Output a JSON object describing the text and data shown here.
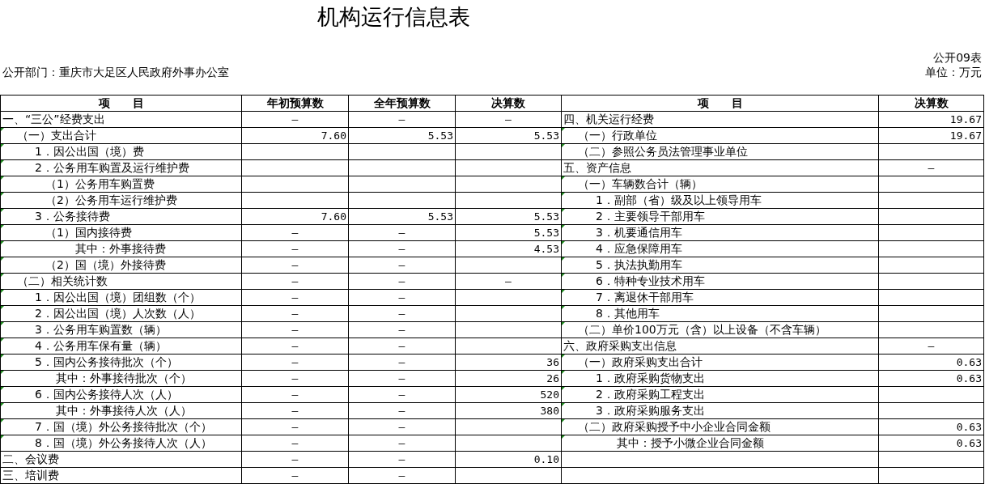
{
  "title": "机构运行信息表",
  "form_no": "公开09表",
  "department": "公开部门：重庆市大足区人民政府外事办公室",
  "unit": "单位：万元",
  "left_columns": [
    "项　　目",
    "年初预算数",
    "全年预算数",
    "决算数"
  ],
  "right_columns": [
    "项　　目",
    "决算数"
  ],
  "left_rows": [
    {
      "kind": "section",
      "flagged": false,
      "item": "一、“三公”经费支出",
      "values": [
        "—",
        "—",
        "—"
      ]
    },
    {
      "kind": "group",
      "flagged": true,
      "item": "（一）支出合计",
      "values": [
        "7.60",
        "5.53",
        "5.53"
      ]
    },
    {
      "kind": "item",
      "flagged": true,
      "item": "1．因公出国（境）费",
      "values": []
    },
    {
      "kind": "item",
      "flagged": true,
      "item": "2．公务用车购置及运行维护费",
      "values": []
    },
    {
      "kind": "subitem",
      "flagged": true,
      "item": "（1）公务用车购置费",
      "values": []
    },
    {
      "kind": "subitem",
      "flagged": true,
      "item": "（2）公务用车运行维护费",
      "values": []
    },
    {
      "kind": "item",
      "flagged": true,
      "item": "3．公务接待费",
      "values": [
        "7.60",
        "5.53",
        "5.53"
      ]
    },
    {
      "kind": "subitem",
      "flagged": true,
      "item": "（1）国内接待费",
      "values": [
        "—",
        "—",
        "5.53"
      ]
    },
    {
      "kind": "subnote",
      "flagged": true,
      "item": "其中：外事接待费",
      "values": [
        "—",
        "—",
        "4.53"
      ]
    },
    {
      "kind": "subitem",
      "flagged": true,
      "item": "（2）国（境）外接待费",
      "values": [
        "—",
        "—"
      ]
    },
    {
      "kind": "group",
      "flagged": true,
      "item": "（二）相关统计数",
      "values": [
        "—",
        "—",
        "—"
      ]
    },
    {
      "kind": "item",
      "flagged": true,
      "item": "1．因公出国（境）团组数（个）",
      "values": [
        "—",
        "—"
      ]
    },
    {
      "kind": "item",
      "flagged": true,
      "item": "2．因公出国（境）人次数（人）",
      "values": [
        "—",
        "—"
      ]
    },
    {
      "kind": "item",
      "flagged": true,
      "item": "3．公务用车购置数（辆）",
      "values": [
        "—",
        "—"
      ]
    },
    {
      "kind": "item",
      "flagged": true,
      "item": "4．公务用车保有量（辆）",
      "values": [
        "—",
        "—"
      ]
    },
    {
      "kind": "item",
      "flagged": true,
      "item": "5．国内公务接待批次（个）",
      "values": [
        "—",
        "—",
        "36"
      ]
    },
    {
      "kind": "note",
      "flagged": true,
      "item": "其中：外事接待批次（个）",
      "values": [
        "—",
        "—",
        "26"
      ]
    },
    {
      "kind": "item",
      "flagged": true,
      "item": "6．国内公务接待人次（人）",
      "values": [
        "—",
        "—",
        "520"
      ]
    },
    {
      "kind": "note",
      "flagged": true,
      "item": "其中：外事接待人次（人）",
      "values": [
        "—",
        "—",
        "380"
      ]
    },
    {
      "kind": "item",
      "flagged": true,
      "item": "7．国（境）外公务接待批次（个）",
      "values": [
        "—",
        "—"
      ]
    },
    {
      "kind": "item",
      "flagged": true,
      "item": "8．国（境）外公务接待人次（人）",
      "values": [
        "—",
        "—"
      ]
    },
    {
      "kind": "section",
      "flagged": false,
      "item": "二、会议费",
      "values": [
        "—",
        "—",
        "0.10"
      ]
    },
    {
      "kind": "section",
      "flagged": false,
      "item": "三、培训费",
      "values": [
        "—",
        "—"
      ]
    }
  ],
  "right_rows": [
    {
      "kind": "section",
      "flagged": false,
      "item": "四、机关运行经费",
      "final": "19.67"
    },
    {
      "kind": "group",
      "flagged": true,
      "item": "（一）行政单位",
      "final": "19.67"
    },
    {
      "kind": "group",
      "flagged": true,
      "item": "（二）参照公务员法管理事业单位"
    },
    {
      "kind": "section",
      "flagged": false,
      "item": "五、资产信息",
      "final": "—"
    },
    {
      "kind": "group",
      "flagged": true,
      "item": "（一）车辆数合计（辆）"
    },
    {
      "kind": "item",
      "flagged": true,
      "item": "1．副部（省）级及以上领导用车"
    },
    {
      "kind": "item",
      "flagged": true,
      "item": "2．主要领导干部用车"
    },
    {
      "kind": "item",
      "flagged": true,
      "item": "3．机要通信用车"
    },
    {
      "kind": "item",
      "flagged": true,
      "item": "4．应急保障用车"
    },
    {
      "kind": "item",
      "flagged": true,
      "item": "5．执法执勤用车"
    },
    {
      "kind": "item",
      "flagged": true,
      "item": "6．特种专业技术用车"
    },
    {
      "kind": "item",
      "flagged": true,
      "item": "7．离退休干部用车"
    },
    {
      "kind": "item",
      "flagged": true,
      "item": "8．其他用车"
    },
    {
      "kind": "group",
      "flagged": true,
      "item": "（二）单价100万元（含）以上设备（不含车辆）"
    },
    {
      "kind": "section",
      "flagged": false,
      "item": "六、政府采购支出信息",
      "final": "—"
    },
    {
      "kind": "group",
      "flagged": true,
      "item": "（一）政府采购支出合计",
      "final": "0.63"
    },
    {
      "kind": "item",
      "flagged": true,
      "item": "1．政府采购货物支出",
      "final": "0.63"
    },
    {
      "kind": "item",
      "flagged": true,
      "item": "2．政府采购工程支出"
    },
    {
      "kind": "item",
      "flagged": true,
      "item": "3．政府采购服务支出"
    },
    {
      "kind": "group",
      "flagged": true,
      "item": "（二）政府采购授予中小企业合同金额",
      "final": "0.63"
    },
    {
      "kind": "note",
      "flagged": true,
      "item": "其中：授予小微企业合同金额",
      "final": "0.63"
    }
  ]
}
